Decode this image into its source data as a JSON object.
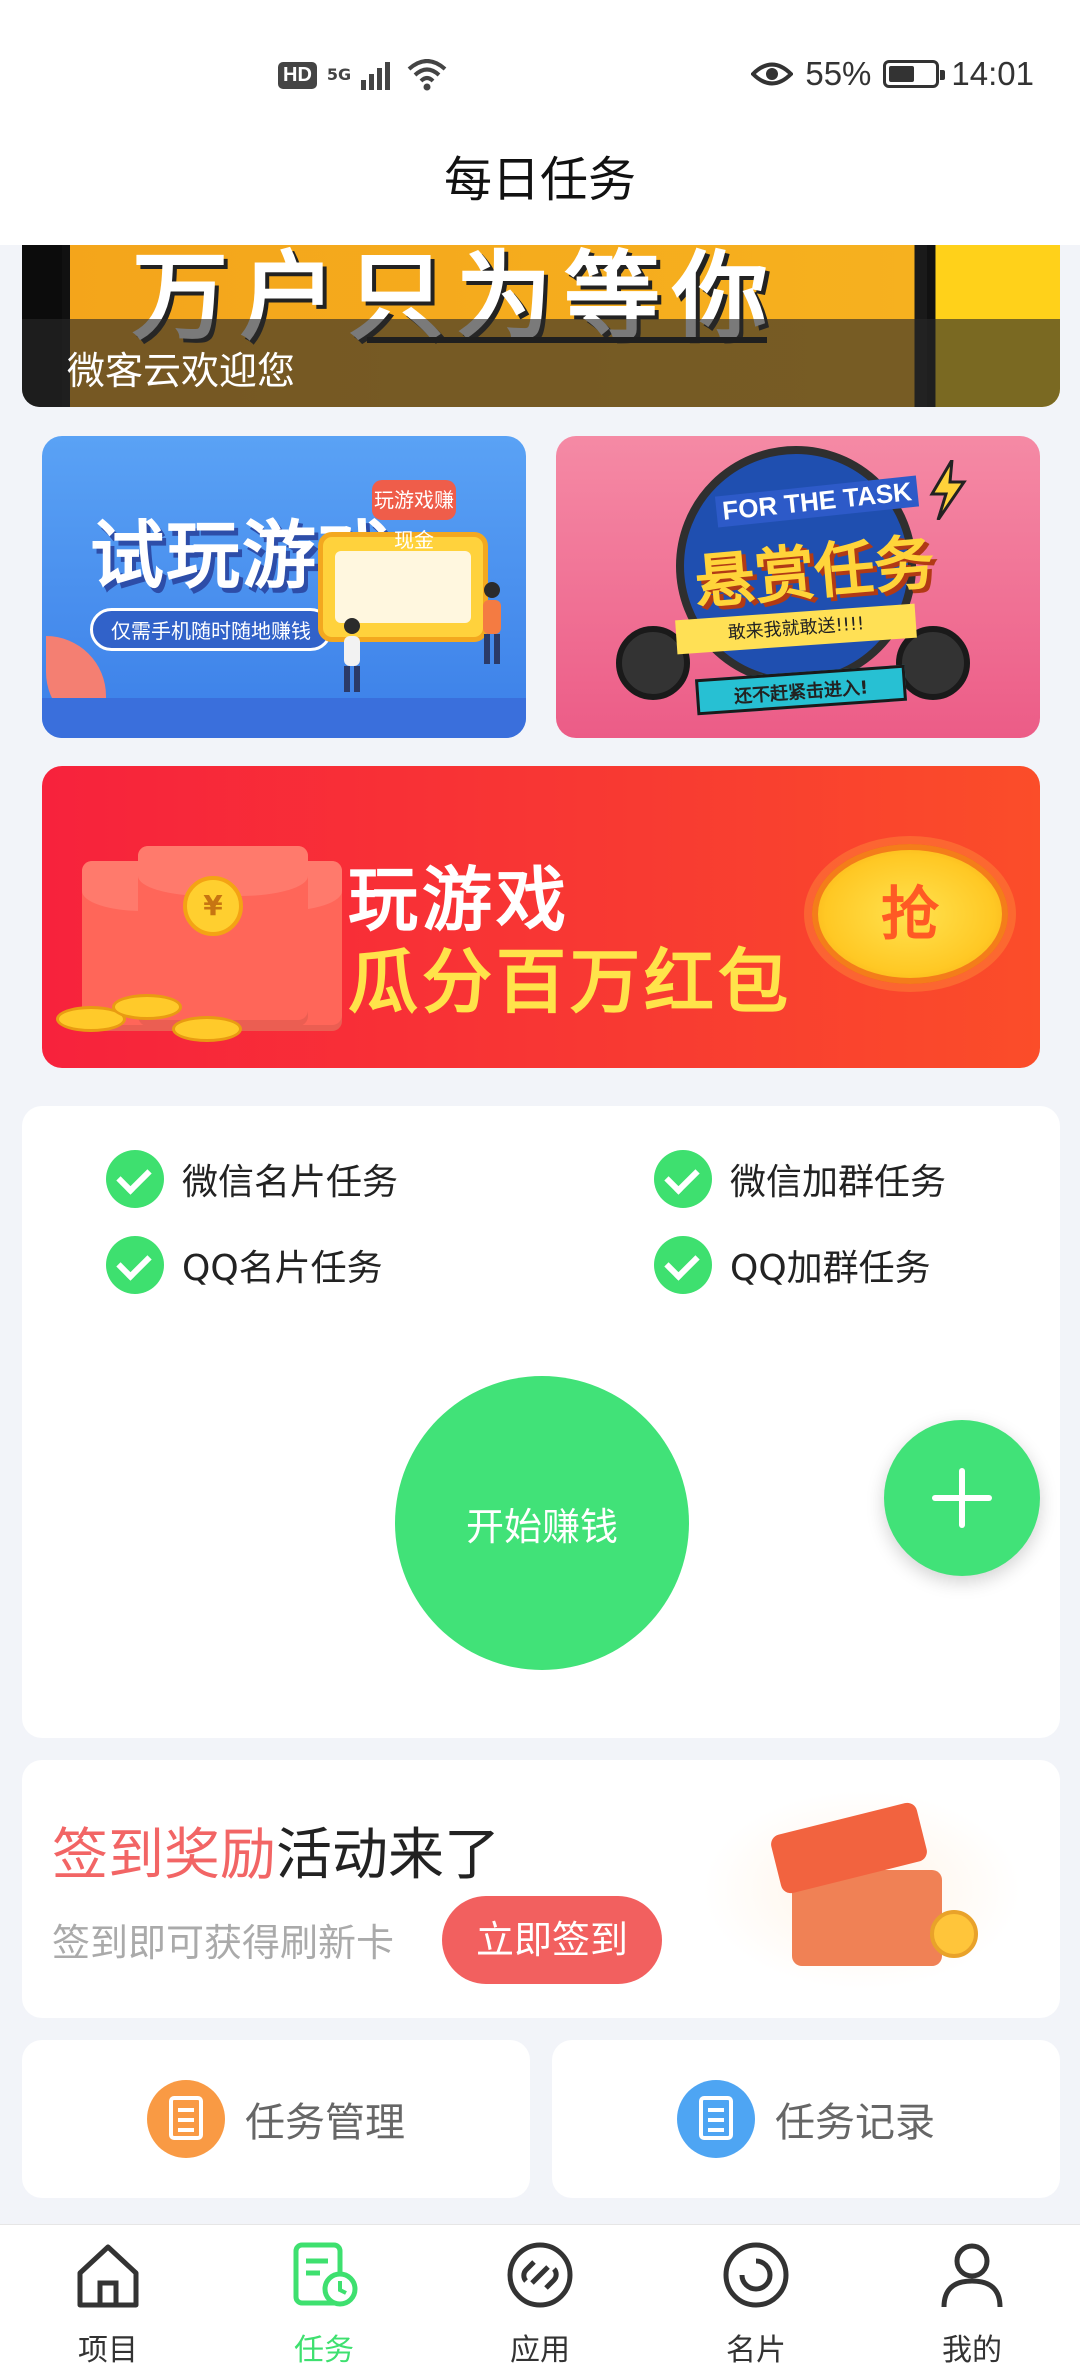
{
  "status_bar": {
    "hd_label": "HD",
    "network_label": "5G",
    "battery_percent": "55%",
    "battery_level": 0.55,
    "time": "14:01"
  },
  "header": {
    "title": "每日任务"
  },
  "top_banner": {
    "image_text": "万户只为等你",
    "caption": "微客云欢迎您"
  },
  "promo_left": {
    "title": "试玩游戏",
    "subtitle": "仅需手机随时随地赚钱",
    "bubble_text": "玩游戏赚现金"
  },
  "promo_right": {
    "english_title": "FOR THE TASK",
    "title": "悬赏任务",
    "ribbon_text": "敢来我就敢送!!!!",
    "ribbon_text2": "还不赶紧击进入!"
  },
  "red_banner": {
    "line1": "玩游戏",
    "line2": "瓜分百万红包",
    "grab_label": "抢",
    "coin_symbol": "¥"
  },
  "task_card": {
    "items": [
      {
        "label": "微信名片任务"
      },
      {
        "label": "微信加群任务"
      },
      {
        "label": "QQ名片任务"
      },
      {
        "label": "QQ加群任务"
      }
    ],
    "start_button": "开始赚钱"
  },
  "sign_card": {
    "title_highlight": "签到奖励",
    "title_rest": "活动来了",
    "subtitle": "签到即可获得刷新卡",
    "button": "立即签到"
  },
  "shortcuts": {
    "manage": "任务管理",
    "record": "任务记录"
  },
  "bottom_nav": {
    "items": [
      {
        "label": "项目"
      },
      {
        "label": "任务"
      },
      {
        "label": "应用"
      },
      {
        "label": "名片"
      },
      {
        "label": "我的"
      }
    ],
    "active_index": 1
  },
  "colors": {
    "accent_green": "#41e278",
    "sign_red": "#f2605f",
    "page_bg": "#f2f4f9"
  }
}
